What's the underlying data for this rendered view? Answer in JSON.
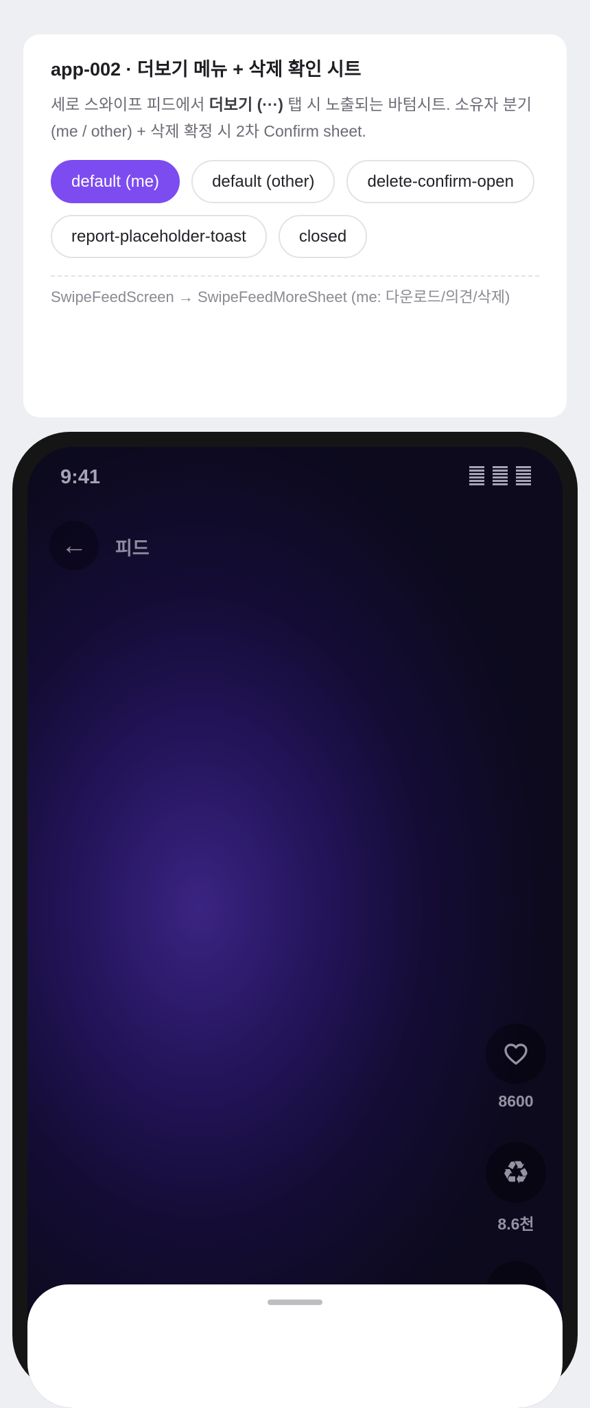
{
  "card": {
    "title": "app-002 · 더보기 메뉴 + 삭제 확인 시트",
    "desc_prefix": "세로 스와이프 피드에서 ",
    "desc_bold": "더보기 (···)",
    "desc_suffix": " 탭 시 노출되는 바텀시트. 소유자 분기 (me / other) + 삭제 확정 시 2차 Confirm sheet.",
    "chips": [
      {
        "label": "default (me)",
        "active": true
      },
      {
        "label": "default (other)",
        "active": false
      },
      {
        "label": "delete-confirm-open",
        "active": false
      },
      {
        "label": "report-placeholder-toast",
        "active": false
      },
      {
        "label": "closed",
        "active": false
      }
    ],
    "footer": "SwipeFeedScreen → SwipeFeedMoreSheet (me: 다운로드/의견/삭제)"
  },
  "phone": {
    "status_time": "9:41",
    "back_icon": "back-arrow-icon",
    "back_glyph": "←",
    "header_title": "피드",
    "actions": [
      {
        "icon": "heart-icon",
        "count": "8600"
      },
      {
        "icon": "recycle-icon",
        "glyph": "♻",
        "count": "8.6천"
      }
    ]
  },
  "colors": {
    "accent": "#7c4cf0",
    "page_bg": "#eeeff2",
    "phone_frame": "#151515",
    "feed_bg": "#23145a"
  }
}
